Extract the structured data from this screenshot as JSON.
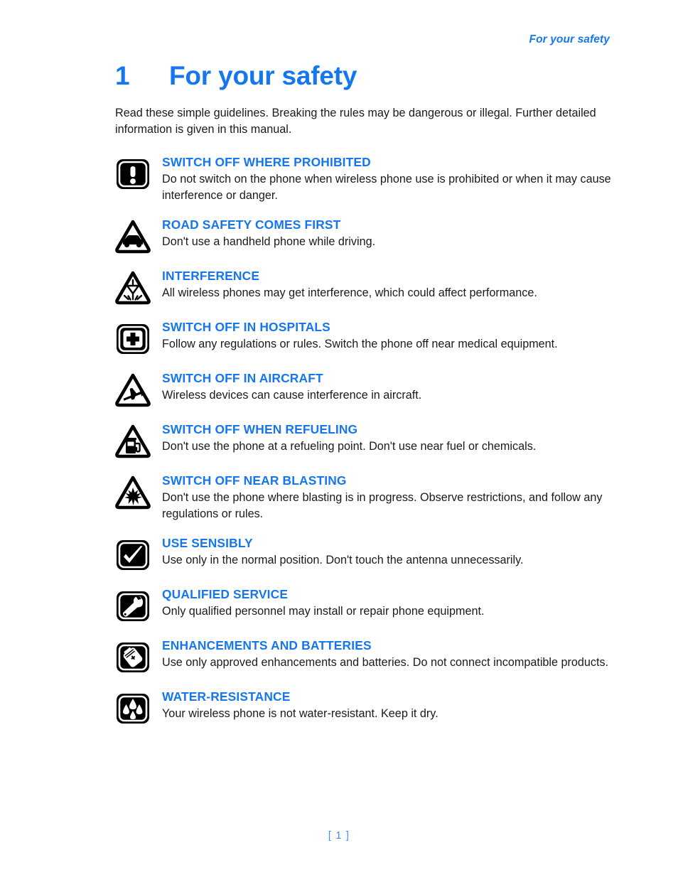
{
  "header": {
    "running_head": "For your safety"
  },
  "title": {
    "number": "1",
    "text": "For your safety"
  },
  "intro": "Read these simple guidelines. Breaking the rules may be dangerous or illegal. Further detailed information is given in this manual.",
  "colors": {
    "accent_blue": "#1577ef",
    "footer_blue": "#3d8ff2",
    "body_text": "#1a1a1a",
    "icon_black": "#000000"
  },
  "safety_items": [
    {
      "icon": "exclamation-rounded-square-icon",
      "heading": "SWITCH OFF WHERE PROHIBITED",
      "body": "Do not switch on the phone when wireless phone use is prohibited or when it may cause interference or danger."
    },
    {
      "icon": "car-triangle-icon",
      "heading": "ROAD SAFETY COMES FIRST",
      "body": "Don't use a handheld phone while driving."
    },
    {
      "icon": "antenna-interference-triangle-icon",
      "heading": "INTERFERENCE",
      "body": "All wireless phones may get interference, which could affect performance."
    },
    {
      "icon": "hospital-cross-rounded-square-icon",
      "heading": "SWITCH OFF IN HOSPITALS",
      "body": "Follow any regulations or rules. Switch the phone off near medical equipment."
    },
    {
      "icon": "airplane-triangle-icon",
      "heading": "SWITCH OFF IN AIRCRAFT",
      "body": "Wireless devices can cause interference in aircraft."
    },
    {
      "icon": "fuel-pump-triangle-icon",
      "heading": "SWITCH OFF WHEN REFUELING",
      "body": "Don't use the phone at a refueling point. Don't use near fuel or chemicals."
    },
    {
      "icon": "explosion-blasting-triangle-icon",
      "heading": "SWITCH OFF NEAR BLASTING",
      "body": "Don't use the phone where blasting is in progress. Observe restrictions, and follow any regulations or rules."
    },
    {
      "icon": "checkmark-rounded-square-icon",
      "heading": "USE SENSIBLY",
      "body": "Use only in the normal position. Don't touch the antenna unnecessarily."
    },
    {
      "icon": "wrench-rounded-square-icon",
      "heading": "QUALIFIED SERVICE",
      "body": "Only qualified personnel may install or repair phone equipment."
    },
    {
      "icon": "battery-rounded-square-icon",
      "heading": "ENHANCEMENTS AND BATTERIES",
      "body": "Use only approved enhancements and batteries. Do not connect incompatible products."
    },
    {
      "icon": "water-drops-rounded-square-icon",
      "heading": "WATER-RESISTANCE",
      "body": "Your wireless phone is not water-resistant. Keep it dry."
    }
  ],
  "footer": {
    "page_number": "[ 1 ]"
  }
}
